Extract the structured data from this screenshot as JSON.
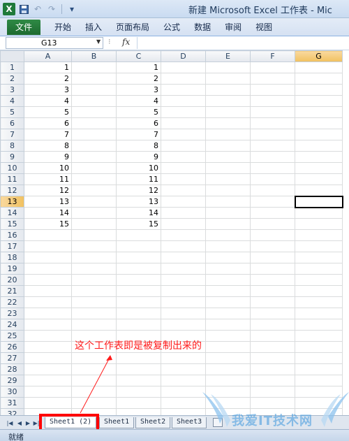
{
  "window": {
    "title": "新建 Microsoft Excel 工作表 - Mic"
  },
  "quick_access": {
    "logo_letter": "X",
    "save_icon": "save-icon",
    "undo_icon": "undo-icon",
    "redo_icon": "redo-icon",
    "customize_icon": "customize-qat-icon"
  },
  "ribbon": {
    "file_label": "文件",
    "tabs": [
      "开始",
      "插入",
      "页面布局",
      "公式",
      "数据",
      "审阅",
      "视图"
    ]
  },
  "formula_bar": {
    "name_box": "G13",
    "fx_label": "fx",
    "formula_value": ""
  },
  "grid": {
    "columns": [
      "A",
      "B",
      "C",
      "D",
      "E",
      "F",
      "G"
    ],
    "selected_column": "G",
    "selected_row": 13,
    "active_cell": "G13",
    "row_numbers": [
      1,
      2,
      3,
      4,
      5,
      6,
      7,
      8,
      9,
      10,
      11,
      12,
      13,
      14,
      15,
      16,
      17,
      18,
      19,
      20,
      21,
      22,
      23,
      24,
      25,
      26,
      27,
      28,
      29,
      30,
      31,
      32
    ],
    "column_a": [
      "1",
      "2",
      "3",
      "4",
      "5",
      "6",
      "7",
      "8",
      "9",
      "10",
      "11",
      "12",
      "13",
      "14",
      "15"
    ],
    "column_c": [
      "1",
      "2",
      "3",
      "4",
      "5",
      "6",
      "7",
      "8",
      "9",
      "10",
      "11",
      "12",
      "13",
      "14",
      "15"
    ]
  },
  "sheet_tabs": {
    "tabs": [
      "Sheet1 (2)",
      "Sheet1",
      "Sheet2",
      "Sheet3"
    ],
    "active": "Sheet1 (2)"
  },
  "status_bar": {
    "status": "就绪"
  },
  "annotation": {
    "text": "这个工作表即是被复制出来的"
  },
  "watermark": {
    "text": "我爱IT技术网"
  },
  "colors": {
    "file_tab": "#1d6a30",
    "selected_header": "#f1c15f",
    "annotation": "#ff1a1a",
    "highlight_box": "#ff0000"
  }
}
